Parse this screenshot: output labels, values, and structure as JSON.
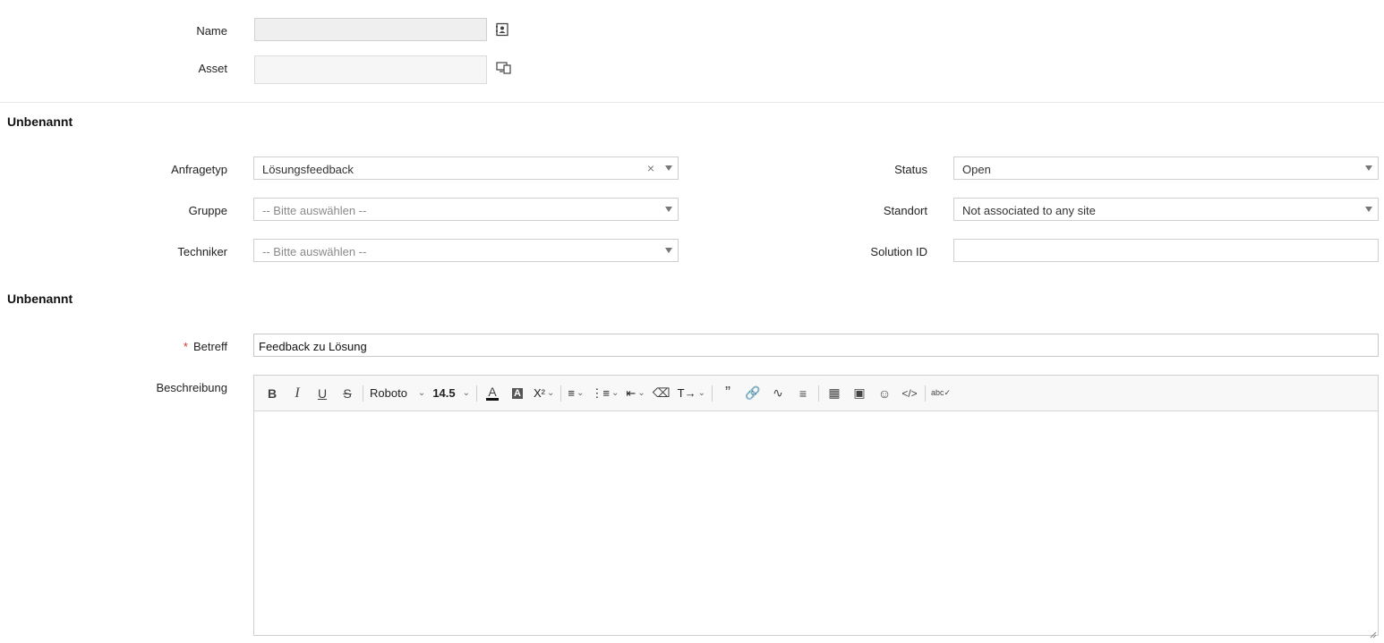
{
  "top_fields": {
    "name_label": "Name",
    "name_value": "",
    "asset_label": "Asset",
    "asset_value": ""
  },
  "sections": [
    {
      "title": "Unbenannt"
    },
    {
      "title": "Unbenannt"
    }
  ],
  "left_fields": {
    "anfragetyp": {
      "label": "Anfragetyp",
      "value": "Lösungsfeedback",
      "clear": "×"
    },
    "gruppe": {
      "label": "Gruppe",
      "placeholder": "-- Bitte auswählen --"
    },
    "techniker": {
      "label": "Techniker",
      "placeholder": "-- Bitte auswählen --"
    }
  },
  "right_fields": {
    "status": {
      "label": "Status",
      "value": "Open"
    },
    "standort": {
      "label": "Standort",
      "value": "Not associated to any site"
    },
    "solution_id": {
      "label": "Solution ID",
      "value": ""
    }
  },
  "betreff": {
    "required_mark": "*",
    "label": "Betreff",
    "value": "Feedback zu Lösung"
  },
  "beschreibung": {
    "label": "Beschreibung",
    "toolbar": {
      "font_family": "Roboto",
      "font_size": "14.5",
      "buttons": [
        "bold-icon",
        "italic-icon",
        "underline-icon",
        "strikethrough-icon",
        "font-color-icon",
        "background-color-icon",
        "superscript-icon",
        "align-icon",
        "list-icon",
        "indent-icon",
        "eraser-icon",
        "text-direction-icon",
        "quote-icon",
        "link-icon",
        "unlink-icon",
        "line-height-icon",
        "table-icon",
        "image-icon",
        "emoji-icon",
        "code-icon",
        "spellcheck-icon"
      ]
    },
    "content": ""
  },
  "colors": {
    "required": "#d9352b",
    "border": "#cfcfcf",
    "readonly_bg": "#efefef"
  }
}
